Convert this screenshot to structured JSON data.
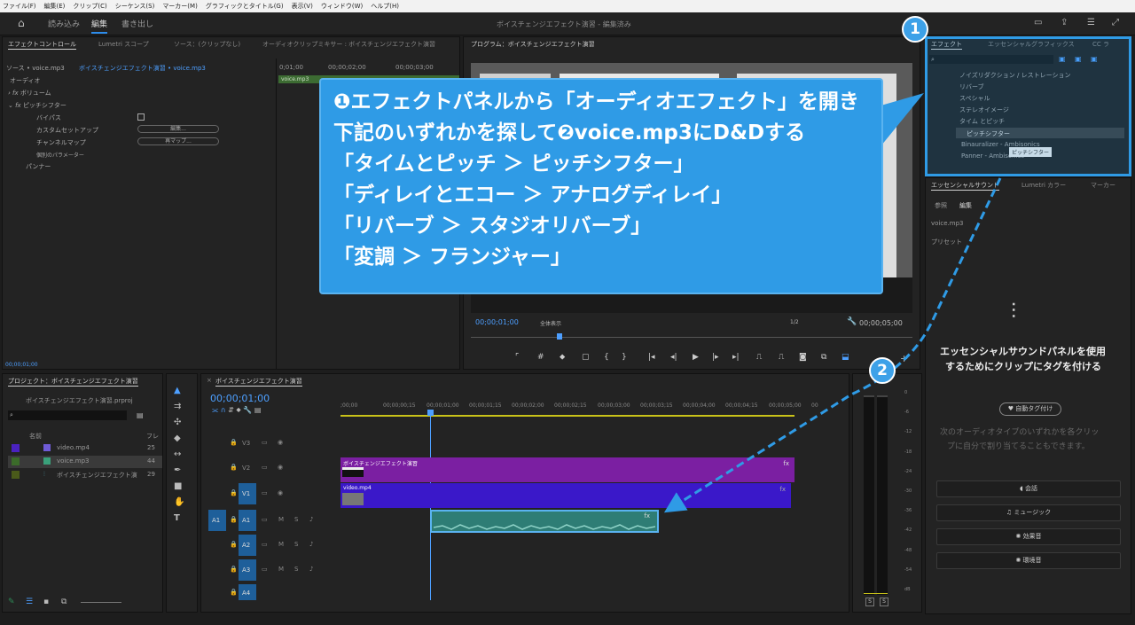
{
  "menu": [
    "ファイル(F)",
    "編集(E)",
    "クリップ(C)",
    "シーケンス(S)",
    "マーカー(M)",
    "グラフィックとタイトル(G)",
    "表示(V)",
    "ウィンドウ(W)",
    "ヘルプ(H)"
  ],
  "appbar": {
    "tabs": [
      "読み込み",
      "編集",
      "書き出し"
    ],
    "title": "ボイスチェンジエフェクト演習 - 編集済み"
  },
  "effect_controls": {
    "tabs": [
      "エフェクトコントロール",
      "Lumetri スコープ",
      "ソース：(クリップなし)",
      "オーディオクリップミキサー : ボイスチェンジエフェクト演習"
    ],
    "source": "ソース • voice.mp3",
    "seq": "ボイスチェンジエフェクト演習 • voice.mp3",
    "ruler": [
      "0;01;00",
      "00;00;02;00",
      "00;00;03;00"
    ],
    "clipname": "voice.mp3",
    "rows": {
      "audio": "オーディオ",
      "volume": "ボリューム",
      "pitch": "ピッチシフター",
      "bypass": "バイパス",
      "custom": "カスタムセットアップ",
      "channel": "チャンネルマップ",
      "params": "個別のパラメーター",
      "panner": "パンナー"
    },
    "edit_btn": "編集...",
    "remap_btn": "再マップ...",
    "timecode": "00;00;01;00"
  },
  "program": {
    "title": "プログラム：ボイスチェンジエフェクト演習",
    "timecode": "00;00;01;00",
    "fit": "全体表示",
    "quality": "1/2",
    "duration": "00;00;05;00"
  },
  "effects": {
    "tabs": [
      "エフェクト",
      "エッセンシャルグラフィックス",
      "CC ラ"
    ],
    "items": [
      "ノイズリダクション / レストレーション",
      "リバーブ",
      "スペシャル",
      "ステレオイメージ",
      "タイム とピッチ",
      "ピッチシフター",
      "Binauralizer - Ambisonics",
      "Panner - Ambisonics"
    ],
    "tooltip": "ピッチシフター"
  },
  "essential": {
    "tabs": [
      "エッセンシャルサウンド",
      "Lumetri カラー",
      "マーカー"
    ],
    "subtabs": [
      "参照",
      "編集"
    ],
    "clip": "voice.mp3",
    "preset": "プリセット",
    "msg1": "エッセンシャルサウンドパネルを使用",
    "msg2": "するためにクリップにタグを付ける",
    "autotag": "自動タグ付け",
    "desc1": "次のオーディオタイプのいずれかを各クリッ",
    "desc2": "プに自分で割り当てることもできます。",
    "buttons": [
      "会話",
      "ミュージック",
      "効果音",
      "環境音"
    ]
  },
  "project": {
    "title": "プロジェクト：ボイスチェンジエフェクト演習",
    "file": "ボイスチェンジエフェクト演習.prproj",
    "col_name": "名前",
    "col_fr": "フレ",
    "items": [
      {
        "name": "video.mp4",
        "fr": "25"
      },
      {
        "name": "voice.mp3",
        "fr": "44"
      },
      {
        "name": "ボイスチェンジエフェクト演",
        "fr": "29"
      }
    ]
  },
  "timeline": {
    "title": "ボイスチェンジエフェクト演習",
    "timecode": "00;00;01;00",
    "ruler": [
      ";00;00",
      "00;00;00;15",
      "00;00;01;00",
      "00;00;01;15",
      "00;00;02;00",
      "00;00;02;15",
      "00;00;03;00",
      "00;00;03;15",
      "00;00;04;00",
      "00;00;04;15",
      "00;00;05;00",
      "00"
    ],
    "tracks": [
      "V3",
      "V2",
      "V1",
      "A1",
      "A2",
      "A3",
      "A4"
    ],
    "src": "A1",
    "clip_v2": "ボイスチェンジエフェクト演習",
    "clip_v1": "video.mp4",
    "clip_a1": "voice.mp3"
  },
  "meter": {
    "scale": [
      "0",
      "-6",
      "-12",
      "-18",
      "-24",
      "-30",
      "-36",
      "-42",
      "-48",
      "-54",
      "dB"
    ],
    "solo": [
      "S",
      "S"
    ]
  },
  "callout": {
    "line1": "❶エフェクトパネルから「オーディオエフェクト」を開き",
    "line2": "下記のいずれかを探して❷voice.mp3にD&Dする",
    "line3": "「タイムとピッチ ＞ ピッチシフター」",
    "line4": "「ディレイとエコー ＞ アナログディレイ」",
    "line5": "「リバーブ ＞ スタジオリバーブ」",
    "line6": "「変調 ＞ フランジャー」"
  },
  "badges": [
    "1",
    "2"
  ],
  "colors": {
    "accent": "#2f9be6",
    "purple": "#7b1fa2",
    "video": "#3a18c9",
    "audio": "#2e7d75"
  }
}
